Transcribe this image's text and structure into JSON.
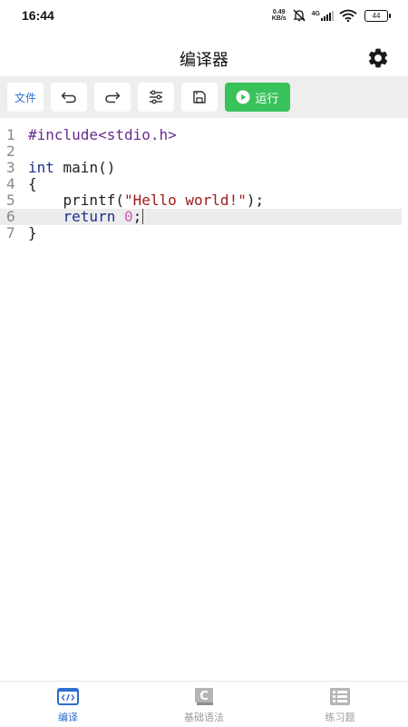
{
  "status_bar": {
    "time": "16:44",
    "net_speed_value": "0.49",
    "net_speed_unit": "KB/s",
    "signal_label": "4G",
    "battery": "44"
  },
  "header": {
    "title": "编译器",
    "settings_icon": "gear-icon"
  },
  "toolbar": {
    "file_label": "文件",
    "undo_icon": "undo-icon",
    "redo_icon": "redo-icon",
    "settings_icon": "sliders-icon",
    "save_icon": "save-icon",
    "run_label": "运行",
    "run_color": "#39c25a"
  },
  "editor": {
    "line_numbers": [
      "1",
      "2",
      "3",
      "4",
      "5",
      "6",
      "7"
    ],
    "active_line": 6,
    "lines": [
      {
        "tokens": [
          {
            "t": "pre",
            "v": "#include<stdio.h>"
          }
        ]
      },
      {
        "tokens": []
      },
      {
        "tokens": [
          {
            "t": "kw",
            "v": "int"
          },
          {
            "t": "plain",
            "v": " main()"
          }
        ]
      },
      {
        "tokens": [
          {
            "t": "plain",
            "v": "{"
          }
        ]
      },
      {
        "tokens": [
          {
            "t": "plain",
            "v": "    printf("
          },
          {
            "t": "str",
            "v": "\"Hello world!\""
          },
          {
            "t": "plain",
            "v": ");"
          }
        ]
      },
      {
        "tokens": [
          {
            "t": "plain",
            "v": "    "
          },
          {
            "t": "kw",
            "v": "return"
          },
          {
            "t": "plain",
            "v": " "
          },
          {
            "t": "num",
            "v": "0"
          },
          {
            "t": "plain",
            "v": ";"
          }
        ]
      },
      {
        "tokens": [
          {
            "t": "plain",
            "v": "}"
          }
        ]
      }
    ]
  },
  "bottom_nav": {
    "active_color": "#2e6fd0",
    "items": [
      {
        "label": "编译",
        "icon": "code-icon",
        "active": true
      },
      {
        "label": "基础语法",
        "icon": "c-book-icon",
        "active": false
      },
      {
        "label": "练习题",
        "icon": "list-icon",
        "active": false
      }
    ]
  }
}
